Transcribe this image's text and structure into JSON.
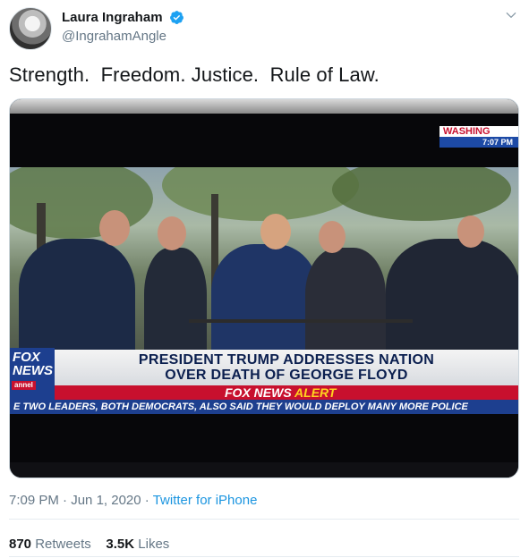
{
  "author": {
    "display_name": "Laura Ingraham",
    "handle": "@IngrahamAngle",
    "verified": true
  },
  "tweet": {
    "text": "Strength.  Freedom. Justice.  Rule of Law."
  },
  "media": {
    "live_location": "WASHING",
    "live_time": "7:07 PM",
    "fox_logo_line1": "FOX",
    "fox_logo_line2": "NEWS",
    "fox_logo_line3": "annel",
    "headline_line1": "PRESIDENT TRUMP ADDRESSES NATION",
    "headline_line2": "OVER DEATH OF GEORGE FLOYD",
    "alert_brand": "FOX NEWS",
    "alert_word": "ALERT",
    "ticker_text": "E TWO LEADERS, BOTH DEMOCRATS, ALSO SAID THEY WOULD DEPLOY MANY MORE POLICE"
  },
  "meta": {
    "time": "7:09 PM",
    "date": "Jun 1, 2020",
    "separator": " · ",
    "source": "Twitter for iPhone"
  },
  "stats": {
    "retweets_count": "870",
    "retweets_label": "Retweets",
    "likes_count": "3.5K",
    "likes_label": "Likes"
  },
  "colors": {
    "verified": "#1da1f2",
    "link": "#1b95e0",
    "secondary_text": "#657786",
    "fox_blue": "#1d3f8f",
    "fox_red": "#c8102e"
  },
  "icons": {
    "verified": "verified-badge-icon",
    "menu": "chevron-down-icon"
  }
}
